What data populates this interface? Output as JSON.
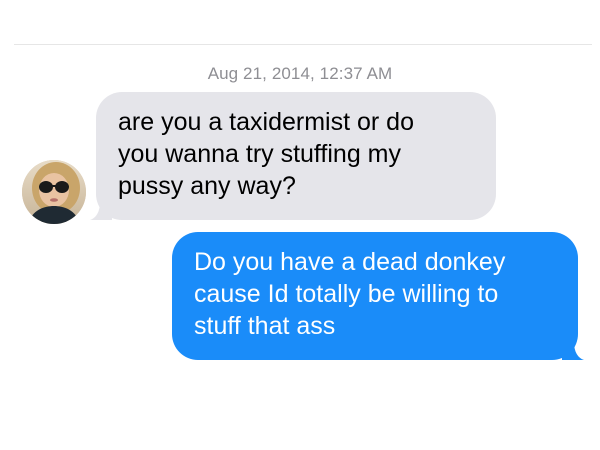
{
  "thread": {
    "timestamp": "Aug 21, 2014, 12:37 AM"
  },
  "messages": [
    {
      "direction": "received",
      "text": "are you a taxidermist or do\nyou wanna try stuffing my\npussy any way?"
    },
    {
      "direction": "sent",
      "text": "Do you have a dead donkey\ncause Id totally be willing to\nstuff that ass"
    }
  ],
  "colors": {
    "received_bubble": "#e5e5ea",
    "sent_bubble": "#1a8cf9",
    "timestamp": "#8e8e93"
  },
  "icons": {
    "contact_avatar": "contact-avatar-photo"
  }
}
